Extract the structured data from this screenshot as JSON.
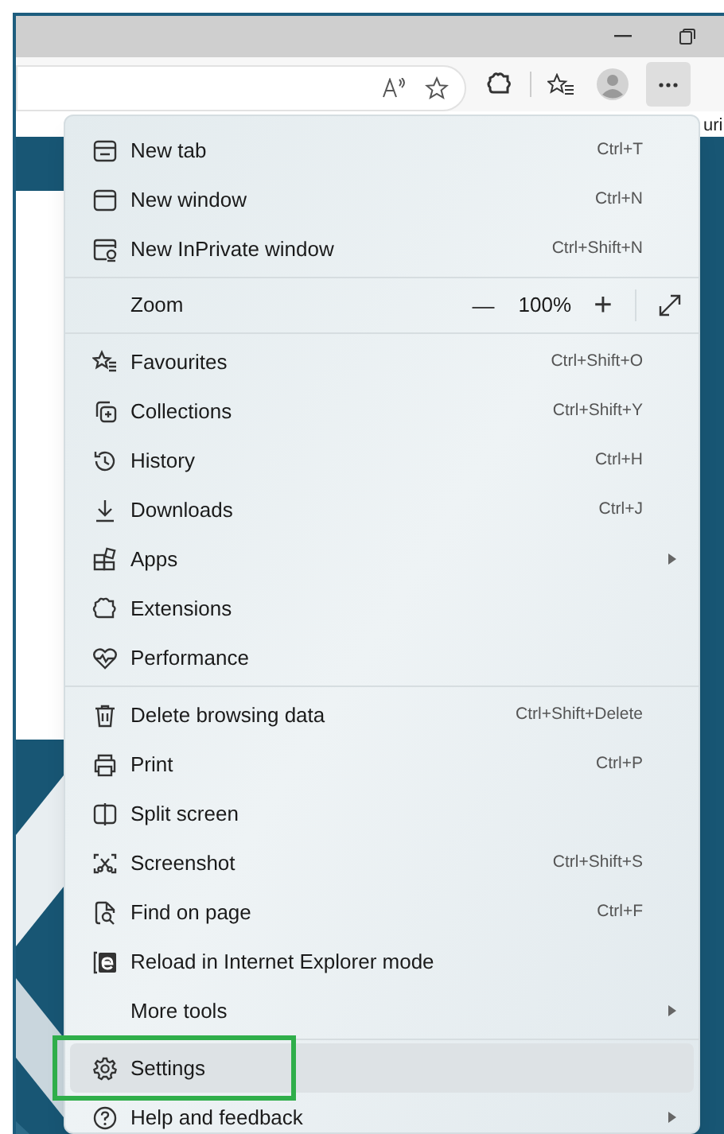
{
  "page": {
    "text": "uri"
  },
  "menu": {
    "items": [
      {
        "kind": "item",
        "label": "New tab",
        "shortcut": "Ctrl+T",
        "submenu": false,
        "selected": false
      },
      {
        "kind": "item",
        "label": "New window",
        "shortcut": "Ctrl+N",
        "submenu": false,
        "selected": false
      },
      {
        "kind": "item",
        "label": "New InPrivate window",
        "shortcut": "Ctrl+Shift+N",
        "submenu": false,
        "selected": false
      },
      {
        "kind": "separator"
      },
      {
        "kind": "zoom",
        "label": "Zoom",
        "value": "100%",
        "minus": "—",
        "plus": "+"
      },
      {
        "kind": "separator"
      },
      {
        "kind": "item",
        "label": "Favourites",
        "shortcut": "Ctrl+Shift+O",
        "submenu": false,
        "selected": false
      },
      {
        "kind": "item",
        "label": "Collections",
        "shortcut": "Ctrl+Shift+Y",
        "submenu": false,
        "selected": false
      },
      {
        "kind": "item",
        "label": "History",
        "shortcut": "Ctrl+H",
        "submenu": false,
        "selected": false
      },
      {
        "kind": "item",
        "label": "Downloads",
        "shortcut": "Ctrl+J",
        "submenu": false,
        "selected": false
      },
      {
        "kind": "item",
        "label": "Apps",
        "submenu": true,
        "selected": false
      },
      {
        "kind": "item",
        "label": "Extensions",
        "submenu": false,
        "selected": false
      },
      {
        "kind": "item",
        "label": "Performance",
        "submenu": false,
        "selected": false
      },
      {
        "kind": "separator"
      },
      {
        "kind": "item",
        "label": "Delete browsing data",
        "shortcut": "Ctrl+Shift+Delete",
        "submenu": false,
        "selected": false
      },
      {
        "kind": "item",
        "label": "Print",
        "shortcut": "Ctrl+P",
        "submenu": false,
        "selected": false
      },
      {
        "kind": "item",
        "label": "Split screen",
        "submenu": false,
        "selected": false
      },
      {
        "kind": "item",
        "label": "Screenshot",
        "shortcut": "Ctrl+Shift+S",
        "submenu": false,
        "selected": false
      },
      {
        "kind": "item",
        "label": "Find on page",
        "shortcut": "Ctrl+F",
        "submenu": false,
        "selected": false
      },
      {
        "kind": "item",
        "label": "Reload in Internet Explorer mode",
        "submenu": false,
        "selected": false
      },
      {
        "kind": "item",
        "label": "More tools",
        "submenu": true,
        "selected": false
      },
      {
        "kind": "separator"
      },
      {
        "kind": "item",
        "label": "Settings",
        "submenu": false,
        "selected": true,
        "highlighted": true
      },
      {
        "kind": "item",
        "label": "Help and feedback",
        "submenu": true,
        "selected": false
      }
    ]
  }
}
